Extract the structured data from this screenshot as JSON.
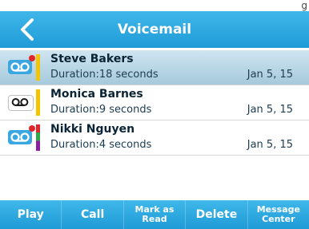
{
  "corner_text": "g",
  "header": {
    "title": "Voicemail",
    "back_icon": "chevron-left-icon"
  },
  "voicemails": [
    {
      "name": "Steve Bakers",
      "duration": "Duration:18 seconds",
      "date": "Jan 5, 15",
      "selected": true,
      "unread": true,
      "bar_color": "#f5c400"
    },
    {
      "name": "Monica Barnes",
      "duration": "Duration:9 seconds",
      "date": "Jan 5, 15",
      "selected": false,
      "unread": false,
      "bar_color": "#f5c400"
    },
    {
      "name": "Nikki Nguyen",
      "duration": "Duration:4 seconds",
      "date": "Jan 5, 15",
      "selected": false,
      "unread": true,
      "bar_color": "#8a1fa3"
    }
  ],
  "toolbar": {
    "play": "Play",
    "call": "Call",
    "mark_as_read": [
      "Mark as",
      "Read"
    ],
    "delete": "Delete",
    "message_center": [
      "Message",
      "Center"
    ]
  },
  "colors": {
    "accent": "#2aa6df",
    "selected_row": "#b9d7e6",
    "unread_dot": "#e0262a"
  }
}
